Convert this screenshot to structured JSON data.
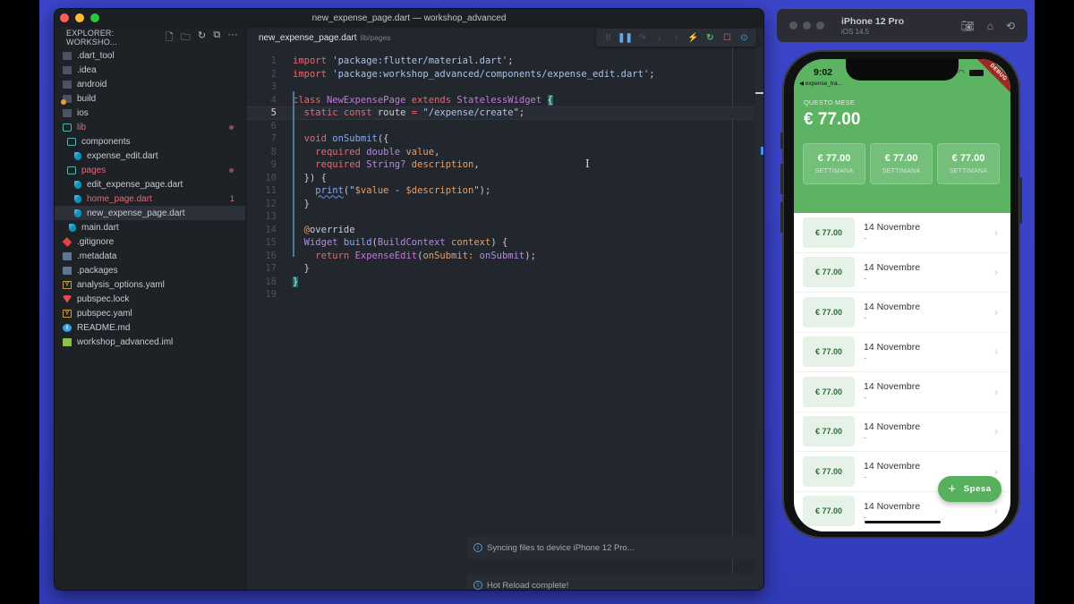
{
  "vscode": {
    "window_title": "new_expense_page.dart — workshop_advanced",
    "explorer_title": "EXPLORER: WORKSHO...",
    "explorer_actions": [
      "new-file",
      "new-folder",
      "refresh",
      "collapse-all",
      "more"
    ],
    "tree": [
      {
        "label": ".dart_tool",
        "type": "folder",
        "depth": 0
      },
      {
        "label": ".idea",
        "type": "folder",
        "depth": 0
      },
      {
        "label": "android",
        "type": "folder",
        "depth": 0
      },
      {
        "label": "build",
        "type": "folder-build",
        "depth": 0
      },
      {
        "label": "ios",
        "type": "folder",
        "depth": 0
      },
      {
        "label": "lib",
        "type": "folder-open",
        "depth": 0,
        "modified": true,
        "dot": true
      },
      {
        "label": "components",
        "type": "folder-open",
        "depth": 1
      },
      {
        "label": "expense_edit.dart",
        "type": "dart",
        "depth": 2
      },
      {
        "label": "pages",
        "type": "folder-open",
        "depth": 1,
        "modified": true,
        "dot": true
      },
      {
        "label": "edit_expense_page.dart",
        "type": "dart",
        "depth": 2
      },
      {
        "label": "home_page.dart",
        "type": "dart",
        "depth": 2,
        "modified": true,
        "badge": "1"
      },
      {
        "label": "new_expense_page.dart",
        "type": "dart",
        "depth": 2,
        "selected": true
      },
      {
        "label": "main.dart",
        "type": "dart",
        "depth": 1
      },
      {
        "label": ".gitignore",
        "type": "git",
        "depth": 0
      },
      {
        "label": ".metadata",
        "type": "doc",
        "depth": 0
      },
      {
        "label": ".packages",
        "type": "doc",
        "depth": 0
      },
      {
        "label": "analysis_options.yaml",
        "type": "yaml",
        "depth": 0
      },
      {
        "label": "pubspec.lock",
        "type": "lock",
        "depth": 0
      },
      {
        "label": "pubspec.yaml",
        "type": "yaml",
        "depth": 0
      },
      {
        "label": "README.md",
        "type": "info",
        "depth": 0
      },
      {
        "label": "workshop_advanced.iml",
        "type": "iml",
        "depth": 0
      }
    ],
    "tab": {
      "name": "new_expense_page.dart",
      "path": "lib/pages"
    },
    "debug_toolbar": [
      "grip",
      "pause",
      "step-over",
      "step-into",
      "step-out",
      "hot-reload",
      "hot-restart",
      "stop",
      "inspect"
    ],
    "current_line": 5,
    "code_lines": [
      "import 'package:flutter/material.dart';",
      "import 'package:workshop_advanced/components/expense_edit.dart';",
      "",
      "class NewExpensePage extends StatelessWidget {",
      "  static const route = \"/expense/create\";",
      "",
      "  void onSubmit({",
      "    required double value,",
      "    required String? description,",
      "  }) {",
      "    print(\"$value - $description\");",
      "  }",
      "",
      "  @override",
      "  Widget build(BuildContext context) {",
      "    return ExpenseEdit(onSubmit: onSubmit);",
      "  }",
      "}",
      ""
    ],
    "notifications": [
      {
        "text": "Syncing files to device iPhone 12 Pro..."
      },
      {
        "text": "Hot Reload complete!"
      }
    ]
  },
  "simulator": {
    "device_name": "iPhone 12 Pro",
    "os_version": "iOS 14.5",
    "actions": [
      "screenshot",
      "home",
      "rotate"
    ]
  },
  "app": {
    "status_time": "9:02",
    "back_label": "◀ expense_tra...",
    "debug_banner": "DEBUG",
    "month_label": "QUESTO MESE",
    "month_total": "€ 77.00",
    "week_cards": [
      {
        "value": "€ 77.00",
        "label": "SETTIMANA"
      },
      {
        "value": "€ 77.00",
        "label": "SETTIMANA"
      },
      {
        "value": "€ 77.00",
        "label": "SETTIMANA"
      }
    ],
    "expenses": [
      {
        "amount": "€ 77.00",
        "date": "14 Novembre",
        "description": "-"
      },
      {
        "amount": "€ 77.00",
        "date": "14 Novembre",
        "description": "-"
      },
      {
        "amount": "€ 77.00",
        "date": "14 Novembre",
        "description": "-"
      },
      {
        "amount": "€ 77.00",
        "date": "14 Novembre",
        "description": "-"
      },
      {
        "amount": "€ 77.00",
        "date": "14 Novembre",
        "description": "-"
      },
      {
        "amount": "€ 77.00",
        "date": "14 Novembre",
        "description": "-"
      },
      {
        "amount": "€ 77.00",
        "date": "14 Novembre",
        "description": "-"
      },
      {
        "amount": "€ 77.00",
        "date": "14 Novembre",
        "description": "-"
      }
    ],
    "fab_label": "Spesa",
    "colors": {
      "primary": "#5cb463",
      "amount_bg": "#e6f2e7",
      "amount_text": "#2e6b34"
    }
  }
}
